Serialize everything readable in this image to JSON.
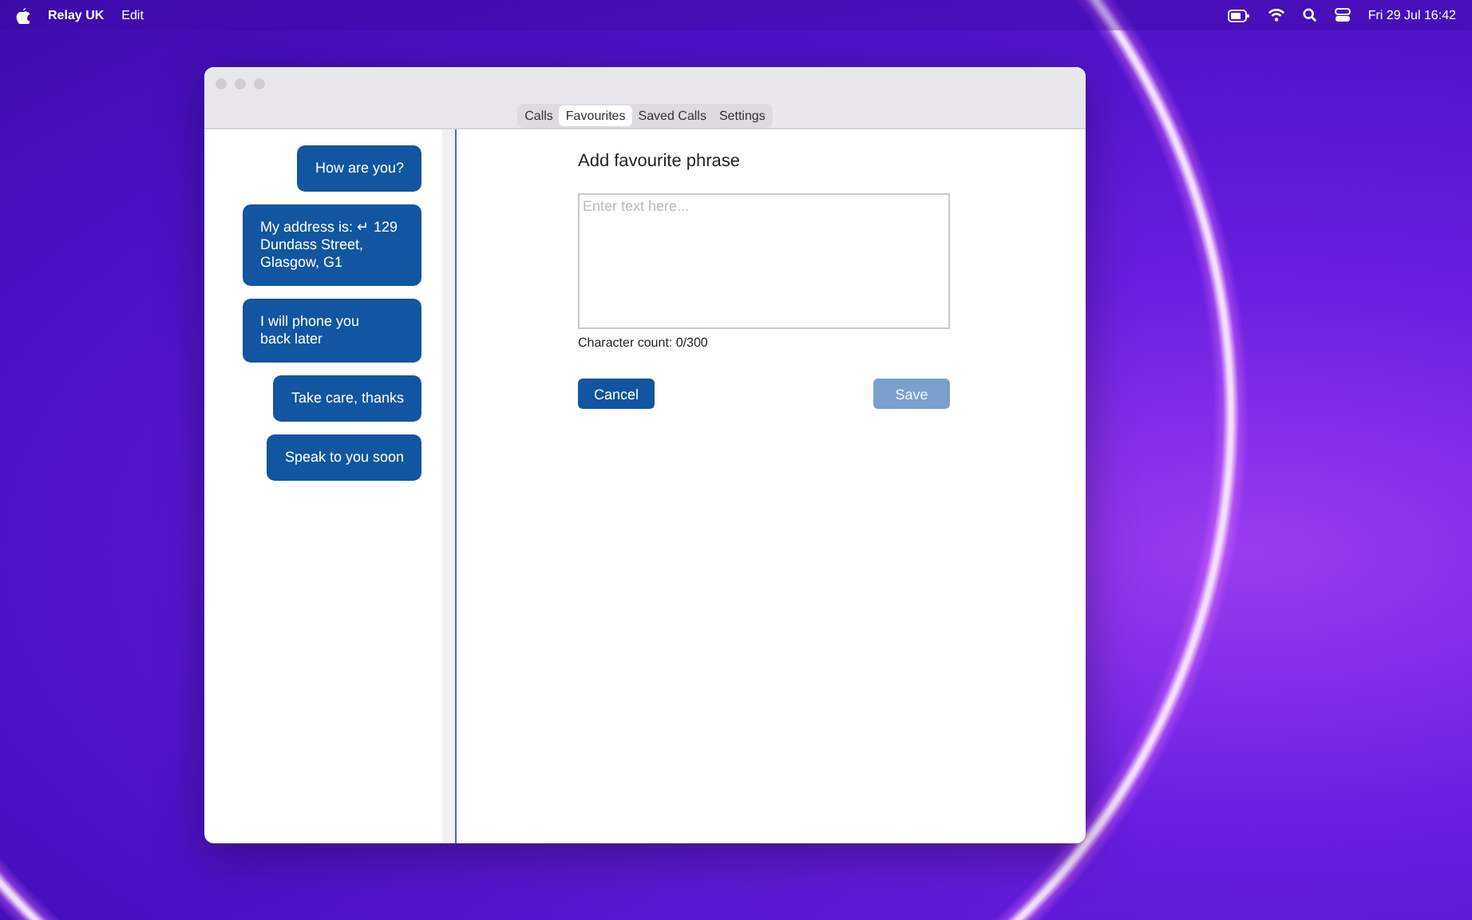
{
  "menu_bar": {
    "app_name": "Relay UK",
    "menus": [
      "Edit"
    ],
    "clock": "Fri 29 Jul 16:42"
  },
  "window": {
    "tabs": [
      {
        "label": "Calls",
        "selected": false
      },
      {
        "label": "Favourites",
        "selected": true
      },
      {
        "label": "Saved Calls",
        "selected": false
      },
      {
        "label": "Settings",
        "selected": false
      }
    ],
    "phrases": [
      "How are you?",
      "My address is: ↵ 129 Dundass Street, Glasgow, G1",
      "I will phone you back later",
      "Take care, thanks",
      "Speak to you soon"
    ],
    "form": {
      "title": "Add favourite phrase",
      "placeholder": "Enter text here...",
      "character_count": "Character count: 0/300",
      "buttons": [
        {
          "label": "Cancel",
          "disabled": false
        },
        {
          "label": "Save",
          "disabled": true
        }
      ]
    }
  }
}
